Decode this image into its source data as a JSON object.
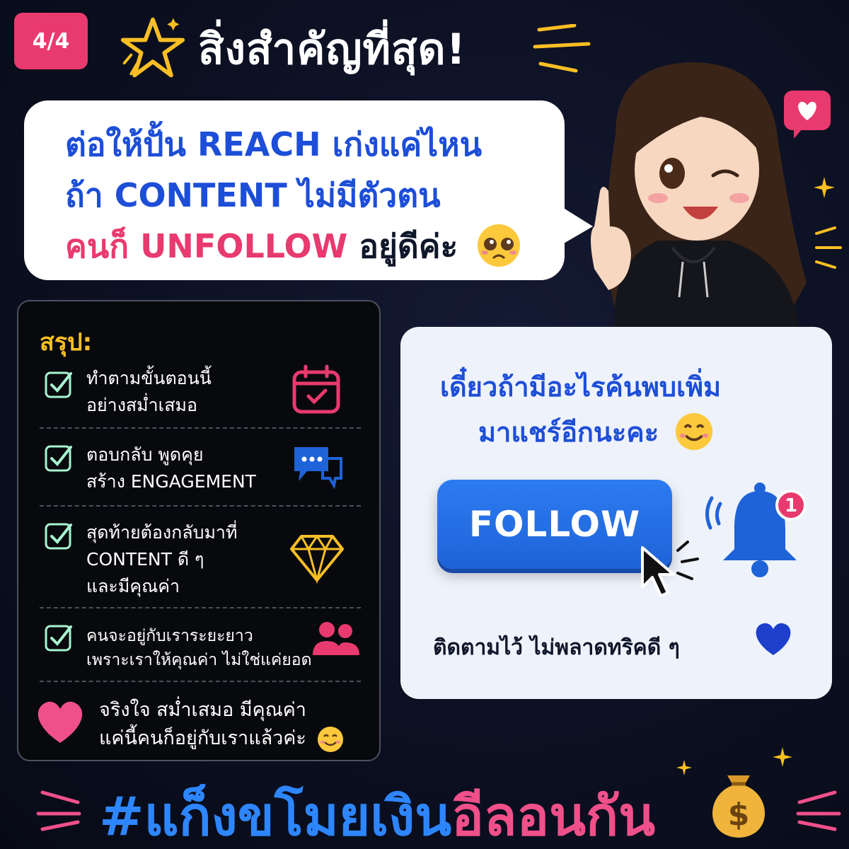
{
  "badge": {
    "page": "4/4"
  },
  "header": {
    "title": "สิ่งสำคัญที่สุด!"
  },
  "bubble": {
    "line1": "ต่อให้ปั้น REACH เก่งแค่ไหน",
    "line2": "ถ้า CONTENT ไม่มีตัวตน",
    "line3_highlight": "คนก็ UNFOLLOW",
    "line3_rest": "อยู่ดีค่ะ"
  },
  "summary": {
    "title": "สรุป:",
    "items": [
      {
        "line1": "ทำตามขั้นตอนนี้",
        "line2": "อย่างสม่ำเสมอ",
        "icon": "calendar-check-icon"
      },
      {
        "line1": "ตอบกลับ พูดคุย",
        "line2": "สร้าง ENGAGEMENT",
        "icon": "chat-bubbles-icon"
      },
      {
        "line1": "สุดท้ายต้องกลับมาที่",
        "line2": "CONTENT ดี ๆ",
        "line3": "และมีคุณค่า",
        "icon": "diamond-icon"
      },
      {
        "line1": "คนจะอยู่กับเราระยะยาว",
        "line2": "เพราะเราให้คุณค่า ไม่ใช่แค่ยอด",
        "icon": "users-icon"
      }
    ],
    "closing": {
      "line1": "จริงใจ สม่ำเสมอ มีคุณค่า",
      "line2": "แค่นี้คนก็อยู่กับเราแล้วค่ะ"
    }
  },
  "follow_card": {
    "line1": "เดี๋ยวถ้ามีอะไรค้นพบเพิ่ม",
    "line2": "มาแชร์อีกนะคะ",
    "button_label": "FOLLOW",
    "notification_count": "1",
    "footer": "ติดตามไว้ ไม่พลาดทริคดี ๆ"
  },
  "hashtag": {
    "part1": "#แก็งขโมยเงิน",
    "part2": "อีลอนกัน"
  },
  "colors": {
    "accent_pink": "#e83a6e",
    "accent_blue": "#1d4ed8",
    "accent_yellow": "#fbbf24",
    "check_green": "#a7f3d0"
  }
}
